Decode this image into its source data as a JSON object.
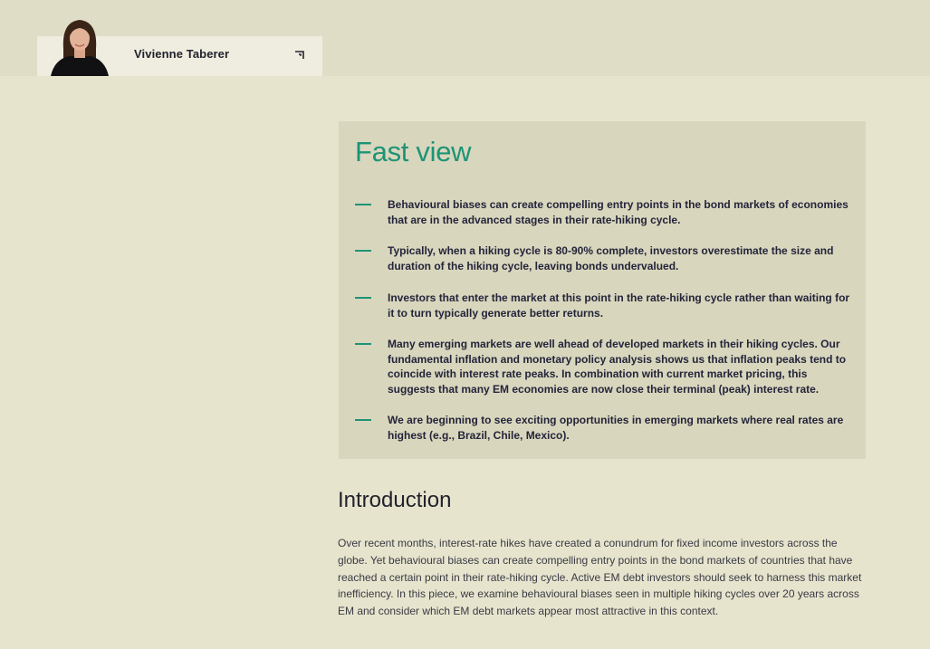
{
  "author": {
    "name": "Vivienne Taberer",
    "avatar_icon": "person-portrait",
    "expand_icon": "corner-arrow-icon"
  },
  "fast_view": {
    "title": "Fast view",
    "items": [
      "Behavioural biases can create compelling entry points in the bond markets of economies that are in the advanced stages in their rate-hiking cycle.",
      "Typically, when a hiking cycle is 80-90% complete, investors overestimate the size and duration of the hiking cycle, leaving bonds undervalued.",
      "Investors that enter the market at this point in the rate-hiking cycle rather than waiting for it to turn typically generate better returns.",
      "Many emerging markets are well ahead of developed markets in their hiking cycles. Our fundamental inflation and monetary policy analysis shows us that inflation peaks tend to coincide with interest rate peaks. In combination with current market pricing, this suggests that many EM economies are now close their terminal (peak) interest rate.",
      "We are beginning to see exciting opportunities in emerging markets where real rates are highest (e.g., Brazil, Chile, Mexico)."
    ]
  },
  "introduction": {
    "heading": "Introduction",
    "body": "Over recent months, interest-rate hikes have created a conundrum for fixed income investors across the globe. Yet behavioural biases can create compelling entry points in the bond markets of countries that have reached a certain point in their rate-hiking cycle. Active EM debt investors should seek to harness this market inefficiency. In this piece, we examine behavioural biases seen in multiple hiking cycles over 20 years across EM and consider which EM debt markets appear most attractive in this context."
  },
  "colors": {
    "background": "#e6e4cd",
    "panel": "#d8d6bd",
    "accent": "#1d9476",
    "text": "#24243a"
  }
}
